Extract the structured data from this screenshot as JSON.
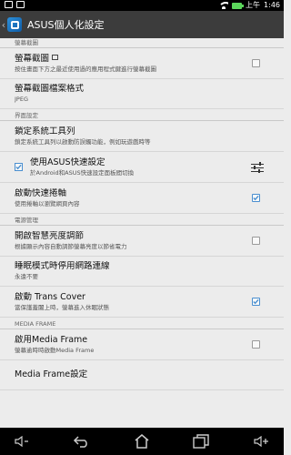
{
  "status_bar": {
    "time_prefix": "上午",
    "time": "1:46",
    "icons": [
      "notification-box-icon",
      "notification-box-icon",
      "wifi-icon",
      "battery-icon"
    ],
    "battery_color": "#5bd65b"
  },
  "action_bar": {
    "title": "ASUS個人化設定",
    "background": "#3c3c3c"
  },
  "sections": {
    "screenshot": "螢幕截圖",
    "ui": "界面設定",
    "power": "電源管理",
    "media_frame": "MEDIA FRAME"
  },
  "items": {
    "screenshot": {
      "title": "螢幕截圖",
      "summary": "按住畫面下方之最近使用過的應用程式鍵進行螢幕截圖",
      "checked": false
    },
    "screenshot_format": {
      "title": "螢幕截圖檔案格式",
      "summary": "JPEG"
    },
    "lock_toolbar": {
      "title": "鎖定系統工具列",
      "summary": "鎖定系統工具列以啟動防誤觸功能，例如玩遊戲時等"
    },
    "asus_quick_settings": {
      "title": "使用ASUS快速設定",
      "summary": "於Android和ASUS快速設定面板間切換",
      "checked": true
    },
    "quick_scroll": {
      "title": "啟動快速捲軸",
      "summary": "使用捲軸以瀏覽網頁內容",
      "checked": true
    },
    "smart_brightness": {
      "title": "開啟智慧亮度調節",
      "summary": "根據顯示內容自動調節螢幕亮度以節省電力",
      "checked": false
    },
    "sleep_network": {
      "title": "睡眠模式時停用網路連線",
      "summary": "永遠不要"
    },
    "trans_cover": {
      "title": "啟動 Trans Cover",
      "summary": "當保護蓋闔上時，螢幕進入休眠狀態",
      "checked": true
    },
    "enable_media_frame": {
      "title": "啟用Media Frame",
      "summary": "螢幕逾時時啟動Media Frame",
      "checked": false
    },
    "media_frame_settings": {
      "title": "Media Frame設定"
    }
  },
  "colors": {
    "checkbox_accent": "#4a8fd0",
    "list_background": "#ececec"
  }
}
